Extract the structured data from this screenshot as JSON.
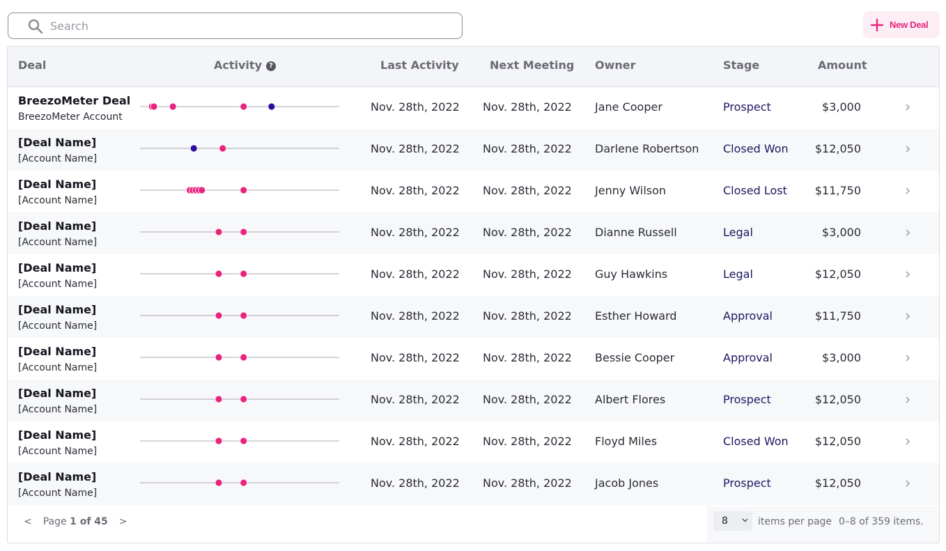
{
  "search": {
    "placeholder": "Search",
    "value": ""
  },
  "toolbar": {
    "new_deal_label": "New Deal"
  },
  "colors": {
    "accent": "#e8247e",
    "activity_pink": "#e8247e",
    "activity_navy": "#2f0c9e",
    "stage_text": "#1c1660"
  },
  "table": {
    "headers": {
      "deal": "Deal",
      "activity": "Activity",
      "activity_help": "?",
      "last_activity": "Last Activity",
      "next_meeting": "Next Meeting",
      "owner": "Owner",
      "stage": "Stage",
      "amount": "Amount"
    },
    "rows": [
      {
        "deal": "BreezoMeter Deal",
        "account": "BreezoMeter Account",
        "last_activity": "Nov. 28th, 2022",
        "next_meeting": "Nov. 28th, 2022",
        "owner": "Jane Cooper",
        "stage": "Prospect",
        "amount": "$3,000",
        "activity": [
          {
            "pos": 0.06,
            "kind": "pink"
          },
          {
            "pos": 0.07,
            "kind": "pink"
          },
          {
            "pos": 0.165,
            "kind": "pink"
          },
          {
            "pos": 0.52,
            "kind": "pink"
          },
          {
            "pos": 0.66,
            "kind": "navy"
          }
        ]
      },
      {
        "deal": "[Deal Name]",
        "account": "[Account Name]",
        "last_activity": "Nov. 28th, 2022",
        "next_meeting": "Nov. 28th, 2022",
        "owner": "Darlene Robertson",
        "stage": "Closed Won",
        "amount": "$12,050",
        "activity": [
          {
            "pos": 0.27,
            "kind": "navy"
          },
          {
            "pos": 0.415,
            "kind": "pink"
          }
        ]
      },
      {
        "deal": "[Deal Name]",
        "account": "[Account Name]",
        "last_activity": "Nov. 28th, 2022",
        "next_meeting": "Nov. 28th, 2022",
        "owner": "Jenny Wilson",
        "stage": "Closed Lost",
        "amount": "$11,750",
        "activity": [
          {
            "pos": 0.25,
            "kind": "pink"
          },
          {
            "pos": 0.265,
            "kind": "pink"
          },
          {
            "pos": 0.28,
            "kind": "pink"
          },
          {
            "pos": 0.295,
            "kind": "pink"
          },
          {
            "pos": 0.31,
            "kind": "pink"
          },
          {
            "pos": 0.52,
            "kind": "pink"
          }
        ]
      },
      {
        "deal": "[Deal Name]",
        "account": "[Account Name]",
        "last_activity": "Nov. 28th, 2022",
        "next_meeting": "Nov. 28th, 2022",
        "owner": "Dianne Russell",
        "stage": "Legal",
        "amount": "$3,000",
        "activity": [
          {
            "pos": 0.395,
            "kind": "pink"
          },
          {
            "pos": 0.52,
            "kind": "pink"
          }
        ]
      },
      {
        "deal": "[Deal Name]",
        "account": "[Account Name]",
        "last_activity": "Nov. 28th, 2022",
        "next_meeting": "Nov. 28th, 2022",
        "owner": "Guy Hawkins",
        "stage": "Legal",
        "amount": "$12,050",
        "activity": [
          {
            "pos": 0.395,
            "kind": "pink"
          },
          {
            "pos": 0.52,
            "kind": "pink"
          }
        ]
      },
      {
        "deal": "[Deal Name]",
        "account": "[Account Name]",
        "last_activity": "Nov. 28th, 2022",
        "next_meeting": "Nov. 28th, 2022",
        "owner": "Esther Howard",
        "stage": "Approval",
        "amount": "$11,750",
        "activity": [
          {
            "pos": 0.395,
            "kind": "pink"
          },
          {
            "pos": 0.52,
            "kind": "pink"
          }
        ]
      },
      {
        "deal": "[Deal Name]",
        "account": "[Account Name]",
        "last_activity": "Nov. 28th, 2022",
        "next_meeting": "Nov. 28th, 2022",
        "owner": "Bessie Cooper",
        "stage": "Approval",
        "amount": "$3,000",
        "activity": [
          {
            "pos": 0.395,
            "kind": "pink"
          },
          {
            "pos": 0.52,
            "kind": "pink"
          }
        ]
      },
      {
        "deal": "[Deal Name]",
        "account": "[Account Name]",
        "last_activity": "Nov. 28th, 2022",
        "next_meeting": "Nov. 28th, 2022",
        "owner": "Albert Flores",
        "stage": "Prospect",
        "amount": "$12,050",
        "activity": [
          {
            "pos": 0.395,
            "kind": "pink"
          },
          {
            "pos": 0.52,
            "kind": "pink"
          }
        ]
      },
      {
        "deal": "[Deal Name]",
        "account": "[Account Name]",
        "last_activity": "Nov. 28th, 2022",
        "next_meeting": "Nov. 28th, 2022",
        "owner": "Floyd Miles",
        "stage": "Closed Won",
        "amount": "$12,050",
        "activity": [
          {
            "pos": 0.395,
            "kind": "pink"
          },
          {
            "pos": 0.52,
            "kind": "pink"
          }
        ]
      },
      {
        "deal": "[Deal Name]",
        "account": "[Account Name]",
        "last_activity": "Nov. 28th, 2022",
        "next_meeting": "Nov. 28th, 2022",
        "owner": "Jacob Jones",
        "stage": "Prospect",
        "amount": "$12,050",
        "activity": [
          {
            "pos": 0.395,
            "kind": "pink"
          },
          {
            "pos": 0.52,
            "kind": "pink"
          }
        ]
      }
    ]
  },
  "pagination": {
    "prev": "<",
    "next": ">",
    "page_word": "Page",
    "page_of": "1 of 45",
    "per_page_value": "8",
    "items_per_page_label": "items per page",
    "range_text": "0–8 of 359 items."
  }
}
